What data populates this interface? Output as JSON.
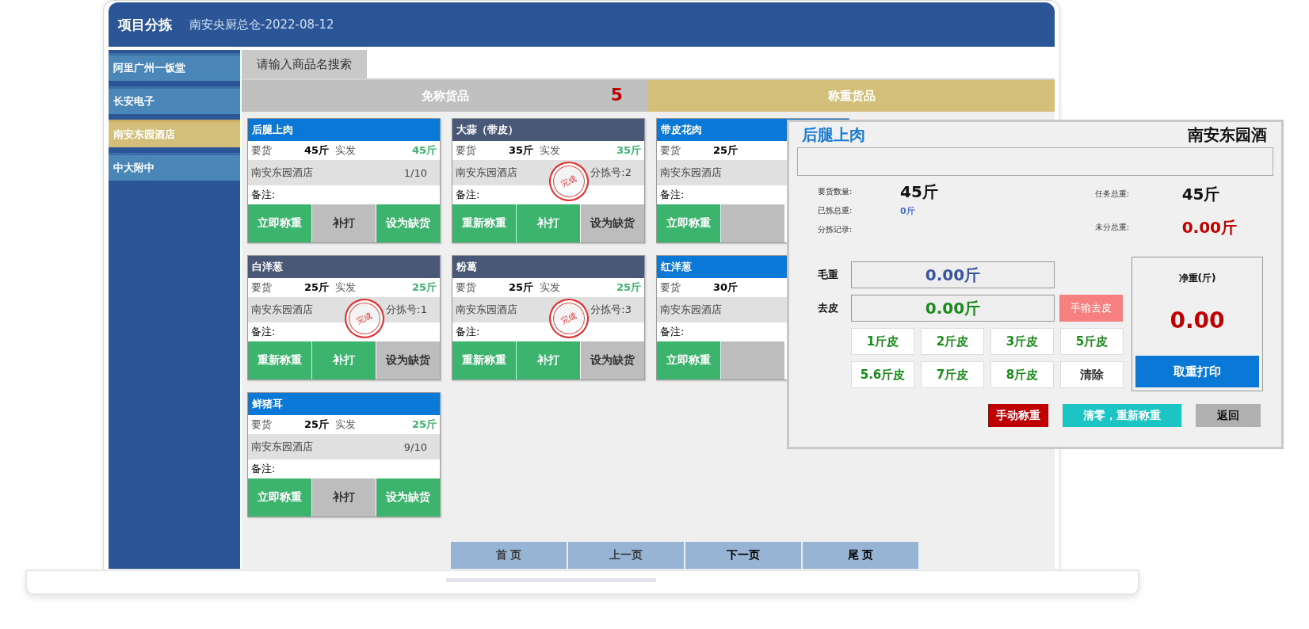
{
  "header": {
    "title": "项目分拣",
    "subtitle": "南安央厨总仓-2022-08-12"
  },
  "sidebar": {
    "items": [
      {
        "label": "阿里广州一饭堂",
        "selected": false
      },
      {
        "label": "长安电子",
        "selected": false
      },
      {
        "label": "南安东园酒店",
        "selected": true
      },
      {
        "label": "中大附中",
        "selected": false
      }
    ]
  },
  "search": {
    "label": "请输入商品名搜索"
  },
  "tabs": [
    {
      "label": "免称货品",
      "count": "5",
      "selected": false
    },
    {
      "label": "称重货品",
      "selected": true
    }
  ],
  "cards": [
    {
      "title": "后腿上肉",
      "done": false,
      "request_label": "要货",
      "request_qty": "45斤",
      "ship_label": "实发",
      "ship_qty": "45斤",
      "store": "南安东园酒店",
      "seq": "1/10",
      "note_label": "备注:",
      "buttons": [
        {
          "label": "立即称重",
          "active": true
        },
        {
          "label": "补打",
          "active": false
        },
        {
          "label": "设为缺货",
          "active": true
        }
      ]
    },
    {
      "title": "大蒜（带皮）",
      "done": true,
      "stamp": "完成",
      "request_label": "要货",
      "request_qty": "35斤",
      "ship_label": "实发",
      "ship_qty": "35斤",
      "store": "南安东园酒店",
      "seq": "分拣号:2",
      "note_label": "备注:",
      "buttons": [
        {
          "label": "重新称重",
          "active": true
        },
        {
          "label": "补打",
          "active": true
        },
        {
          "label": "设为缺货",
          "active": false
        }
      ]
    },
    {
      "title": "带皮花肉",
      "done": false,
      "request_label": "要货",
      "request_qty": "25斤",
      "store": "南安东园酒店",
      "note_label": "备注:",
      "buttons": [
        {
          "label": "立即称重",
          "active": true
        },
        {
          "active": false
        }
      ]
    },
    {
      "title": "白洋葱",
      "done": true,
      "stamp": "完成",
      "request_label": "要货",
      "request_qty": "25斤",
      "ship_label": "实发",
      "ship_qty": "25斤",
      "store": "南安东园酒店",
      "seq": "分拣号:1",
      "note_label": "备注:",
      "buttons": [
        {
          "label": "重新称重",
          "active": true
        },
        {
          "label": "补打",
          "active": true
        },
        {
          "label": "设为缺货",
          "active": false
        }
      ]
    },
    {
      "title": "粉葛",
      "done": true,
      "stamp": "完成",
      "request_label": "要货",
      "request_qty": "25斤",
      "ship_label": "实发",
      "ship_qty": "25斤",
      "store": "南安东园酒店",
      "seq": "分拣号:3",
      "note_label": "备注:",
      "buttons": [
        {
          "label": "重新称重",
          "active": true
        },
        {
          "label": "补打",
          "active": true
        },
        {
          "label": "设为缺货",
          "active": false
        }
      ]
    },
    {
      "title": "红洋葱",
      "done": false,
      "request_label": "要货",
      "request_qty": "30斤",
      "store": "南安东园酒店",
      "note_label": "备注:",
      "buttons": [
        {
          "label": "立即称重",
          "active": true
        },
        {
          "active": false
        }
      ]
    },
    {
      "title": "鲜猪耳",
      "done": false,
      "request_label": "要货",
      "request_qty": "25斤",
      "ship_label": "实发",
      "ship_qty": "25斤",
      "store": "南安东园酒店",
      "seq": "9/10",
      "note_label": "备注:",
      "buttons": [
        {
          "label": "立即称重",
          "active": true
        },
        {
          "label": "补打",
          "active": false
        },
        {
          "label": "设为缺货",
          "active": true
        }
      ]
    }
  ],
  "pagination": [
    {
      "label": "首 页",
      "disabled": true
    },
    {
      "label": "上一页",
      "disabled": true
    },
    {
      "label": "下一页",
      "disabled": false
    },
    {
      "label": "尾 页",
      "disabled": false
    }
  ],
  "dialog": {
    "title": "后腿上肉",
    "store": "南安东园酒",
    "stats_left": [
      {
        "label": "要货数量:",
        "value": "45斤",
        "kind": "big"
      },
      {
        "label": "已拣总重:",
        "value": "0斤",
        "kind": "small"
      },
      {
        "label": "分拣记录:"
      }
    ],
    "stats_right": [
      {
        "label": "任务总重:",
        "value": "45斤",
        "kind": "big"
      },
      {
        "label": "未分总重:",
        "value": "0.00斤",
        "kind": "alert"
      }
    ],
    "gross": {
      "label": "毛重",
      "value": "0.00斤"
    },
    "tare": {
      "label": "去皮",
      "value": "0.00斤",
      "button": "手输去皮"
    },
    "tare_buttons": [
      {
        "label": "1斤皮",
        "kind": "tare"
      },
      {
        "label": "2斤皮",
        "kind": "tare"
      },
      {
        "label": "3斤皮",
        "kind": "tare"
      },
      {
        "label": "5斤皮",
        "kind": "tare"
      },
      {
        "label": "5.6斤皮",
        "kind": "tare"
      },
      {
        "label": "7斤皮",
        "kind": "tare"
      },
      {
        "label": "8斤皮",
        "kind": "tare"
      },
      {
        "label": "清除",
        "kind": "clear"
      }
    ],
    "net": {
      "label": "净重(斤)",
      "value": "0.00",
      "button": "取重打印"
    },
    "actions": [
      {
        "label": "手动称重",
        "kind": "manual"
      },
      {
        "label": "清零，重新称重",
        "kind": "reset"
      },
      {
        "label": "返回",
        "kind": "back"
      }
    ]
  }
}
